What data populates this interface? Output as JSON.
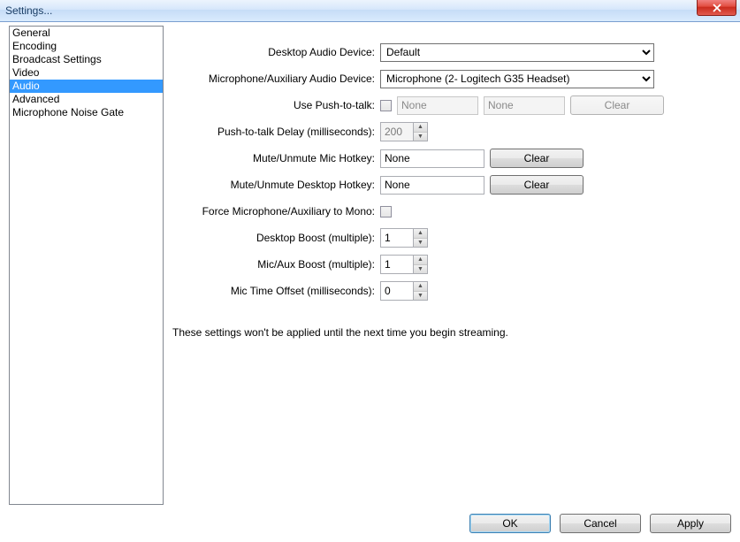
{
  "window": {
    "title": "Settings..."
  },
  "sidebar": {
    "items": [
      {
        "label": "General"
      },
      {
        "label": "Encoding"
      },
      {
        "label": "Broadcast Settings"
      },
      {
        "label": "Video"
      },
      {
        "label": "Audio",
        "selected": true
      },
      {
        "label": "Advanced"
      },
      {
        "label": "Microphone Noise Gate"
      }
    ]
  },
  "form": {
    "desktop_device_label": "Desktop Audio Device:",
    "desktop_device_value": "Default",
    "mic_device_label": "Microphone/Auxiliary Audio Device:",
    "mic_device_value": "Microphone (2- Logitech G35 Headset)",
    "ptt_label": "Use Push-to-talk:",
    "ptt_hotkey1": "None",
    "ptt_hotkey2": "None",
    "ptt_clear": "Clear",
    "ptt_delay_label": "Push-to-talk Delay (milliseconds):",
    "ptt_delay_value": "200",
    "mute_mic_label": "Mute/Unmute Mic Hotkey:",
    "mute_mic_value": "None",
    "mute_mic_clear": "Clear",
    "mute_desk_label": "Mute/Unmute Desktop Hotkey:",
    "mute_desk_value": "None",
    "mute_desk_clear": "Clear",
    "force_mono_label": "Force Microphone/Auxiliary to Mono:",
    "desktop_boost_label": "Desktop Boost (multiple):",
    "desktop_boost_value": "1",
    "mic_boost_label": "Mic/Aux Boost (multiple):",
    "mic_boost_value": "1",
    "mic_offset_label": "Mic Time Offset (milliseconds):",
    "mic_offset_value": "0",
    "note": "These settings won't be applied until the next time you begin streaming."
  },
  "footer": {
    "ok": "OK",
    "cancel": "Cancel",
    "apply": "Apply"
  }
}
